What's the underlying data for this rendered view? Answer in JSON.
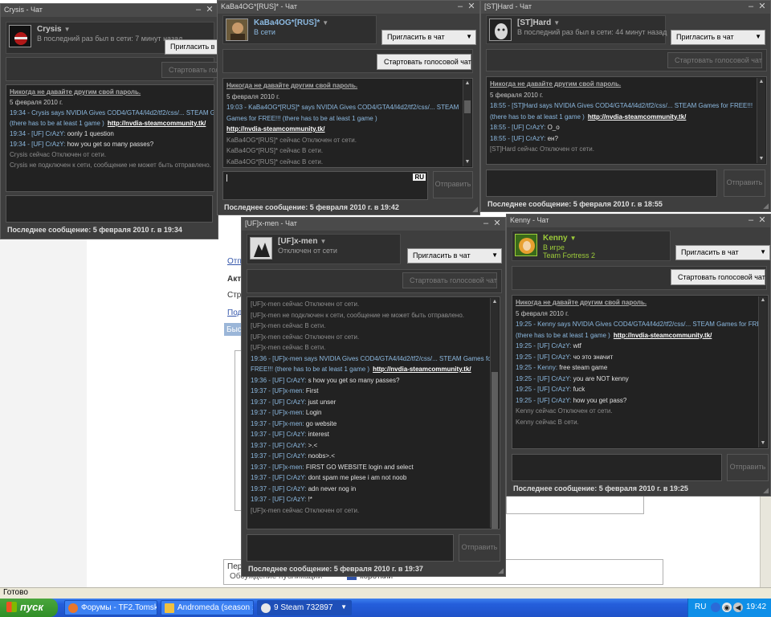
{
  "browser": {
    "status_text": "Готово",
    "fragments": [
      {
        "name": "fragment-otp",
        "text": "Отп"
      },
      {
        "name": "fragment-akt",
        "text": "Акт"
      },
      {
        "name": "fragment-stra",
        "text": "Стра"
      },
      {
        "name": "fragment-pod",
        "text": "Под"
      },
      {
        "name": "fragment-bys",
        "text": "Быс"
      },
      {
        "name": "fragment-per",
        "text": "Пер"
      },
      {
        "name": "fragment-obsuzhdenie",
        "text": "Обсуждение публикации"
      },
      {
        "name": "fragment-korotko",
        "text": "короткий"
      }
    ]
  },
  "windows": {
    "crysis": {
      "title": "Crysis - Чат",
      "username": "Crysis",
      "status": "В последний раз был в сети: 7 минут назад",
      "invite_label": "Пригласить в чат",
      "voice_label": "Стартовать голосовой чат",
      "lines": [
        {
          "cls": "warn",
          "text": "Никогда не давайте другим свой пароль."
        },
        {
          "cls": "plain",
          "text": "5 февраля 2010 г."
        },
        {
          "cls": "blue",
          "text": "19:34 - Crysis says NVIDIA Gives COD4/GTA4/l4d2/tf2/css/... STEAM Games for FREE!!!"
        },
        {
          "cls": "blue",
          "text": "(there has to be at least 1 game )",
          "link": "http://nvdia-steamcommunity.tk/"
        },
        {
          "cls": "blue",
          "text": "19:34 - [UF] CrAzY: ",
          "msg": "oonly 1 question"
        },
        {
          "cls": "blue",
          "text": "19:34 - [UF] CrAzY: ",
          "msg": "how you get so many passes?"
        },
        {
          "cls": "sys",
          "text": "Crysis сейчас Отключен от сети."
        },
        {
          "cls": "sys",
          "text": "Crysis не подключен к сети, сообщение не может быть отправлено."
        }
      ],
      "last_message": "Последнее сообщение: 5 февраля 2010 г. в 19:34"
    },
    "kaba": {
      "title": "KaBa4OG*[RUS]* - Чат",
      "username": "KaBa4OG*[RUS]*",
      "status": "В сети",
      "invite_label": "Пригласить в чат",
      "voice_label": "Стартовать голосовой чат",
      "lines": [
        {
          "cls": "warn",
          "text": "Никогда не давайте другим свой пароль."
        },
        {
          "cls": "plain",
          "text": "5 февраля 2010 г."
        },
        {
          "cls": "blue",
          "text": "19:03 - KaBa4OG*[RUS]* says NVIDIA Gives COD4/GTA4/l4d2/tf2/css/... STEAM"
        },
        {
          "cls": "blue",
          "text": "Games for FREE!!!  (there has to be at least 1 game )"
        },
        {
          "cls": "link",
          "text": "http://nvdia-steamcommunity.tk/"
        },
        {
          "cls": "sys",
          "text": "KaBa4OG*[RUS]* сейчас Отключен от сети."
        },
        {
          "cls": "sys",
          "text": "KaBa4OG*[RUS]* сейчас В сети."
        },
        {
          "cls": "sys",
          "text": "KaBa4OG*[RUS]* сейчас В сети."
        }
      ],
      "input_lang": "RU",
      "send_label": "Отправить",
      "last_message": "Последнее сообщение: 5 февраля 2010 г. в 19:42"
    },
    "hard": {
      "title": "[ST]Hard - Чат",
      "username": "[ST]Hard",
      "status": "В последний раз был в сети: 44 минут назад",
      "invite_label": "Пригласить в чат",
      "voice_label": "Стартовать голосовой чат",
      "lines": [
        {
          "cls": "warn",
          "text": "Никогда не давайте другим свой пароль."
        },
        {
          "cls": "plain",
          "text": "5 февраля 2010 г."
        },
        {
          "cls": "blue",
          "text": "18:55 - [ST]Hard says NVIDIA Gives COD4/GTA4/l4d2/tf2/css/... STEAM Games for FREE!!!"
        },
        {
          "cls": "blue",
          "text": "(there has to be at least 1 game )",
          "link": "http://nvdia-steamcommunity.tk/"
        },
        {
          "cls": "blue",
          "text": "18:55 - [UF] CrAzY: ",
          "msg": "O_o"
        },
        {
          "cls": "blue",
          "text": "18:55 - [UF] CrAzY: ",
          "msg": "ен?"
        },
        {
          "cls": "sys",
          "text": "[ST]Hard сейчас Отключен от сети."
        }
      ],
      "send_label": "Отправить",
      "last_message": "Последнее сообщение: 5 февраля 2010 г. в 18:55"
    },
    "xmen": {
      "title": "[UF]x-men - Чат",
      "username": "[UF]x-men",
      "status": "Отключен от сети",
      "invite_label": "Пригласить в чат",
      "voice_label": "Стартовать голосовой чат",
      "lines": [
        {
          "cls": "sys",
          "text": "[UF]x-men сейчас Отключен от сети."
        },
        {
          "cls": "sys",
          "text": "[UF]x-men не подключен к сети, сообщение не может быть отправлено."
        },
        {
          "cls": "sys",
          "text": "[UF]x-men сейчас В сети."
        },
        {
          "cls": "sys",
          "text": "[UF]x-men сейчас Отключен от сети."
        },
        {
          "cls": "sys",
          "text": "[UF]x-men сейчас В сети."
        },
        {
          "cls": "blue",
          "text": "19:36 - [UF]x-men says NVIDIA Gives COD4/GTA4/l4d2/tf2/css/... STEAM Games for"
        },
        {
          "cls": "blue",
          "text": "FREE!!!  (there has to be at least 1 game )",
          "link": "http://nvdia-steamcommunity.tk/"
        },
        {
          "cls": "blue",
          "text": "19:36 - [UF] CrAzY: ",
          "msg": "s how you get so many passes?"
        },
        {
          "cls": "blue",
          "text": "19:37 - [UF]x-men: ",
          "msg": "First"
        },
        {
          "cls": "blue",
          "text": "19:37 - [UF] CrAzY: ",
          "msg": "just unser"
        },
        {
          "cls": "blue",
          "text": "19:37 - [UF]x-men: ",
          "msg": "Login"
        },
        {
          "cls": "blue",
          "text": "19:37 - [UF]x-men: ",
          "msg": "go website"
        },
        {
          "cls": "blue",
          "text": "19:37 - [UF] CrAzY: ",
          "msg": "interest"
        },
        {
          "cls": "blue",
          "text": "19:37 - [UF] CrAzY: ",
          "msg": ">.<"
        },
        {
          "cls": "blue",
          "text": "19:37 - [UF] CrAzY: ",
          "msg": "noobs>.<"
        },
        {
          "cls": "blue",
          "text": "19:37 - [UF]x-men: ",
          "msg": "FIRST GO WEBSITE login and select"
        },
        {
          "cls": "blue",
          "text": "19:37 - [UF] CrAzY: ",
          "msg": "dont spam me plese i am not noob"
        },
        {
          "cls": "blue",
          "text": "19:37 - [UF] CrAzY: ",
          "msg": "adn never nog in"
        },
        {
          "cls": "blue",
          "text": "19:37 - [UF] CrAzY: ",
          "msg": "!*"
        },
        {
          "cls": "sys",
          "text": "[UF]x-men сейчас Отключен от сети."
        }
      ],
      "send_label": "Отправить",
      "last_message": "Последнее сообщение: 5 февраля 2010 г. в 19:37"
    },
    "kenny": {
      "title": "Kenny - Чат",
      "username": "Kenny",
      "status": "В игре",
      "game": "Team Fortress 2",
      "invite_label": "Пригласить в чат",
      "voice_label": "Стартовать голосовой чат",
      "lines": [
        {
          "cls": "warn",
          "text": "Никогда не давайте другим свой пароль."
        },
        {
          "cls": "plain",
          "text": "5 февраля 2010 г."
        },
        {
          "cls": "blue",
          "text": "19:25 - Kenny says NVIDIA Gives COD4/GTA4/l4d2/tf2/css/... STEAM Games for FREE!!!"
        },
        {
          "cls": "blue",
          "text": "(there has to be at least 1 game )",
          "link": "http://nvdia-steamcommunity.tk/"
        },
        {
          "cls": "blue",
          "text": "19:25 - [UF] CrAzY: ",
          "msg": "wtf"
        },
        {
          "cls": "blue",
          "text": "19:25 - [UF] CrAzY: ",
          "msg": "чо это значит"
        },
        {
          "cls": "blue",
          "text": "19:25 - Kenny: ",
          "msg": "free steam game"
        },
        {
          "cls": "blue",
          "text": "19:25 - [UF] CrAzY: ",
          "msg": "you are NOT kenny"
        },
        {
          "cls": "blue",
          "text": "19:25 - [UF] CrAzY: ",
          "msg": "fuck"
        },
        {
          "cls": "blue",
          "text": "19:25 - [UF] CrAzY: ",
          "msg": "how you get pass?"
        },
        {
          "cls": "sys",
          "text": "Kenny сейчас Отключен от сети."
        },
        {
          "cls": "sys",
          "text": "Kenny сейчас В сети."
        }
      ],
      "send_label": "Отправить",
      "last_message": "Последнее сообщение: 5 февраля 2010 г. в 19:25"
    }
  },
  "taskbar": {
    "start_label": "пуск",
    "items": [
      {
        "label": "Форумы - TF2.Tomsk..."
      },
      {
        "label": "Andromeda (season 1)"
      },
      {
        "label": "9 Steam 732897"
      }
    ],
    "tray": {
      "lang": "RU",
      "clock": "19:42"
    }
  }
}
